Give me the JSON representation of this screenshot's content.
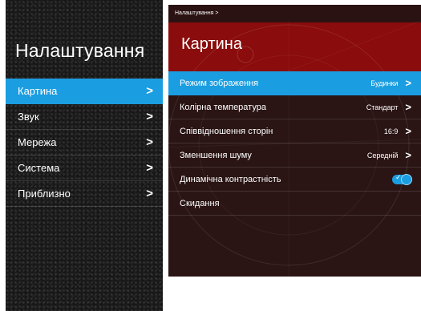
{
  "menu": {
    "title": "Налаштування",
    "items": [
      {
        "label": "Картина",
        "chevron": ">"
      },
      {
        "label": "Звук",
        "chevron": ">"
      },
      {
        "label": "Мережа",
        "chevron": ">"
      },
      {
        "label": "Система",
        "chevron": ">"
      },
      {
        "label": "Приблизно",
        "chevron": ">"
      }
    ]
  },
  "picture": {
    "breadcrumb": "Налаштування >",
    "title": "Картина",
    "rows": [
      {
        "label": "Режим зображення",
        "value": "Будинки",
        "chevron": ">"
      },
      {
        "label": "Колірна температура",
        "value": "Стандарт",
        "chevron": ">"
      },
      {
        "label": "Співвідношення сторін",
        "value": "16:9",
        "chevron": ">"
      },
      {
        "label": "Зменшення шуму",
        "value": "Середній",
        "chevron": ">"
      },
      {
        "label": "Динамічна контрастність",
        "toggle_on": true,
        "toggle_icon": "check-icon"
      },
      {
        "label": "Скидання"
      }
    ]
  },
  "colors": {
    "accent": "#1b9de1",
    "header_red": "#8a0c0c",
    "panel_bg": "#2a1414",
    "menu_bg": "#161616"
  }
}
